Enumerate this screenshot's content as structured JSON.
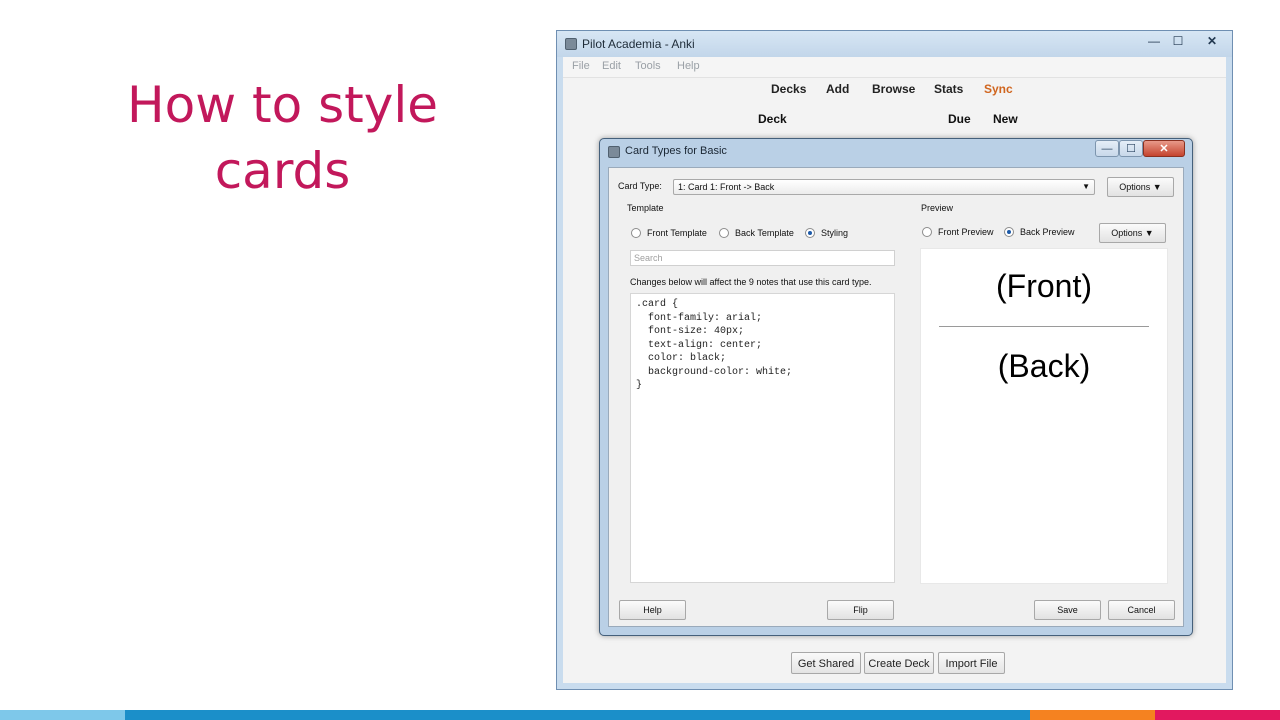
{
  "slide": {
    "title_line1": "How to style",
    "title_line2": "cards",
    "accent_color": "#c2185b"
  },
  "bottom_bar_colors": [
    "#7ec8ea",
    "#1b8fc9",
    "#f58220",
    "#e2185f"
  ],
  "main_window": {
    "title": "Pilot Academia - Anki",
    "controls": {
      "minimize": "—",
      "maximize": "☐",
      "close": "✕"
    },
    "menu": [
      "File",
      "Edit",
      "Tools",
      "Help"
    ],
    "toolbar": {
      "decks": "Decks",
      "add": "Add",
      "browse": "Browse",
      "stats": "Stats",
      "sync": "Sync"
    },
    "deck_table": {
      "deck": "Deck",
      "due": "Due",
      "new": "New"
    },
    "bottom_buttons": {
      "get_shared": "Get Shared",
      "create_deck": "Create Deck",
      "import_file": "Import File"
    }
  },
  "dialog": {
    "title": "Card Types for Basic",
    "controls": {
      "minimize": "—",
      "maximize": "☐",
      "close": "✕"
    },
    "card_type_label": "Card Type:",
    "card_type_value": "1: Card 1: Front -> Back",
    "options_top": "Options ▼",
    "template_group": "Template",
    "preview_group": "Preview",
    "template_radios": {
      "front": "Front Template",
      "back": "Back Template",
      "styling": "Styling",
      "selected": "styling"
    },
    "search_placeholder": "Search",
    "notice": "Changes below will affect the 9 notes that use this card type.",
    "css_lines": [
      ".card {",
      "  font-family: arial;",
      "  font-size: 40px;",
      "  text-align: center;",
      "  color: black;",
      "  background-color: white;",
      "}"
    ],
    "preview_radios": {
      "front": "Front Preview",
      "back": "Back Preview",
      "selected": "back"
    },
    "options_preview": "Options ▼",
    "preview_front_text": "(Front)",
    "preview_back_text": "(Back)",
    "buttons": {
      "help": "Help",
      "flip": "Flip",
      "save": "Save",
      "cancel": "Cancel"
    }
  }
}
